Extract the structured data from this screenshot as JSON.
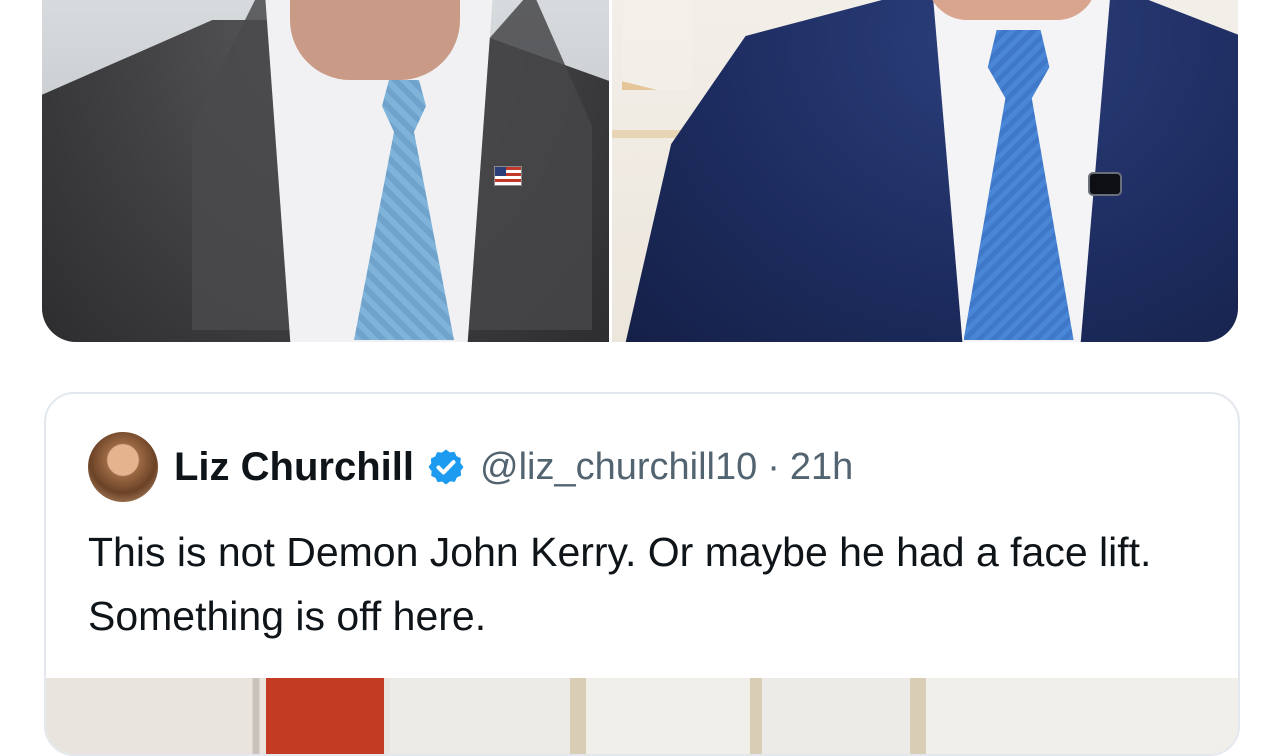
{
  "media_top": {
    "left_photo": "photo-left",
    "right_photo": "photo-right"
  },
  "quote": {
    "author_name": "Liz Churchill",
    "verified": true,
    "handle": "@liz_churchill10",
    "separator": "·",
    "time": "21h",
    "text": "This is not Demon John Kerry. Or maybe he had a face lift. Something is off here.",
    "accent_color": "#1d9bf0"
  }
}
